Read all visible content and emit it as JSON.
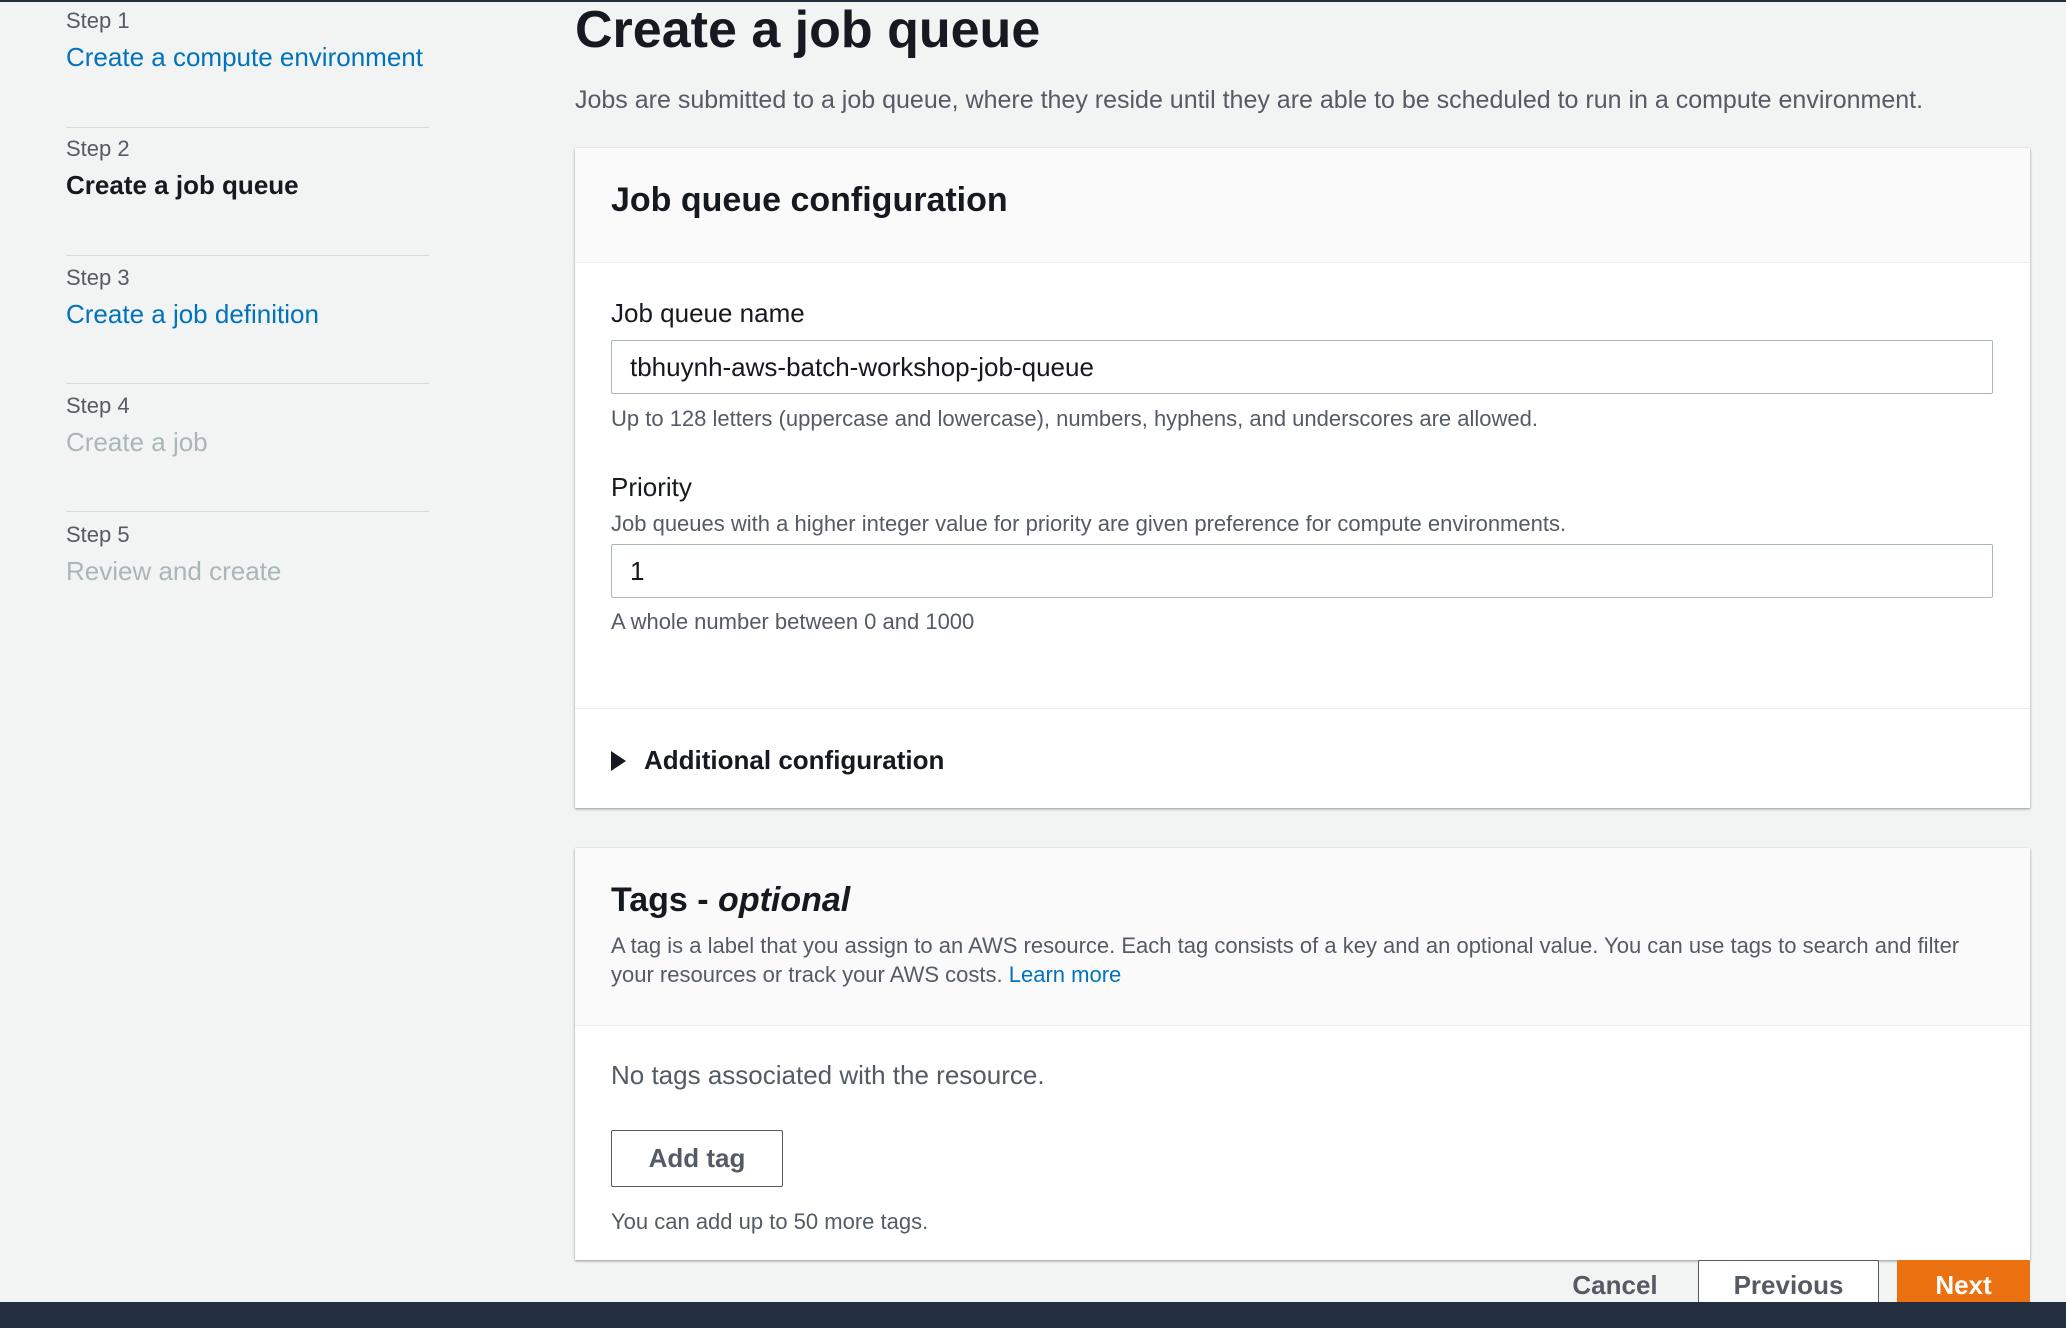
{
  "steps": [
    {
      "num": "Step 1",
      "title": "Create a compute environment",
      "state": "link"
    },
    {
      "num": "Step 2",
      "title": "Create a job queue",
      "state": "current"
    },
    {
      "num": "Step 3",
      "title": "Create a job definition",
      "state": "link"
    },
    {
      "num": "Step 4",
      "title": "Create a job",
      "state": "disabled"
    },
    {
      "num": "Step 5",
      "title": "Review and create",
      "state": "disabled"
    }
  ],
  "page": {
    "title": "Create a job queue",
    "description": "Jobs are submitted to a job queue, where they reside until they are able to be scheduled to run in a compute environment."
  },
  "config": {
    "title": "Job queue configuration",
    "name_label": "Job queue name",
    "name_value": "tbhuynh-aws-batch-workshop-job-queue",
    "name_hint": "Up to 128 letters (uppercase and lowercase), numbers, hyphens, and underscores are allowed.",
    "priority_label": "Priority",
    "priority_desc": "Job queues with a higher integer value for priority are given preference for compute environments.",
    "priority_value": "1",
    "priority_hint": "A whole number between 0 and 1000",
    "additional_label": "Additional configuration"
  },
  "tags": {
    "title_prefix": "Tags - ",
    "title_suffix": "optional",
    "description": "A tag is a label that you assign to an AWS resource. Each tag consists of a key and an optional value. You can use tags to search and filter your resources or track your AWS costs.",
    "learn_more": "Learn more",
    "empty": "No tags associated with the resource.",
    "add_button": "Add tag",
    "limit_hint": "You can add up to 50 more tags."
  },
  "actions": {
    "cancel": "Cancel",
    "previous": "Previous",
    "next": "Next"
  },
  "colors": {
    "link": "#0073bb",
    "primary": "#ec7211",
    "footer": "#232f3e"
  }
}
